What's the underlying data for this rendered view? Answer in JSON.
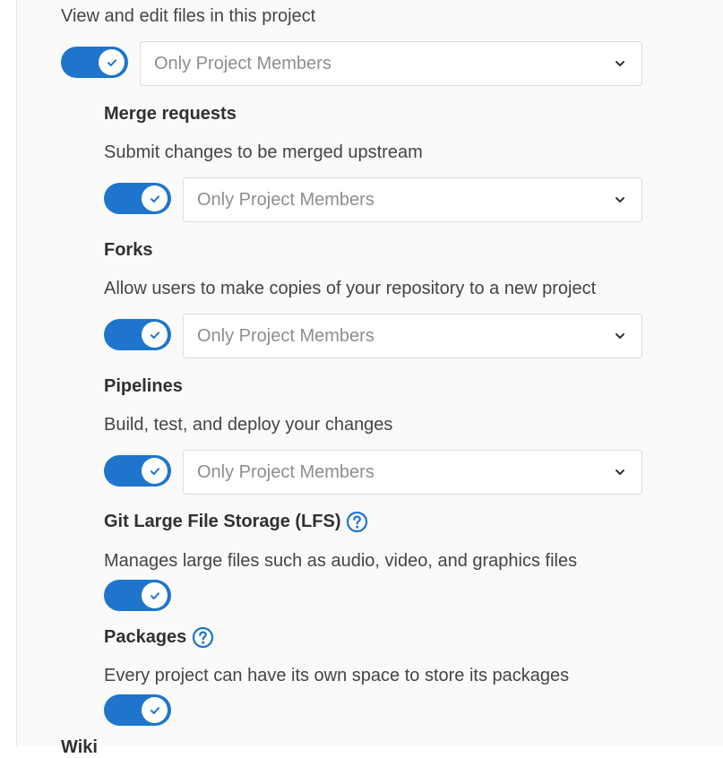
{
  "repository": {
    "description": "View and edit files in this project",
    "access_level": "Only Project Members"
  },
  "merge_requests": {
    "title": "Merge requests",
    "description": "Submit changes to be merged upstream",
    "access_level": "Only Project Members"
  },
  "forks": {
    "title": "Forks",
    "description": "Allow users to make copies of your repository to a new project",
    "access_level": "Only Project Members"
  },
  "pipelines": {
    "title": "Pipelines",
    "description": "Build, test, and deploy your changes",
    "access_level": "Only Project Members"
  },
  "lfs": {
    "title": "Git Large File Storage (LFS)",
    "description": "Manages large files such as audio, video, and graphics files"
  },
  "packages": {
    "title": "Packages",
    "description": "Every project can have its own space to store its packages"
  },
  "next_section": {
    "title": "Wiki"
  },
  "colors": {
    "accent": "#1f75cb",
    "help_icon": "#1f75cb"
  },
  "icons": {
    "toggle_check": "check-icon",
    "dropdown": "chevron-down-icon",
    "help": "question-circle-icon"
  }
}
